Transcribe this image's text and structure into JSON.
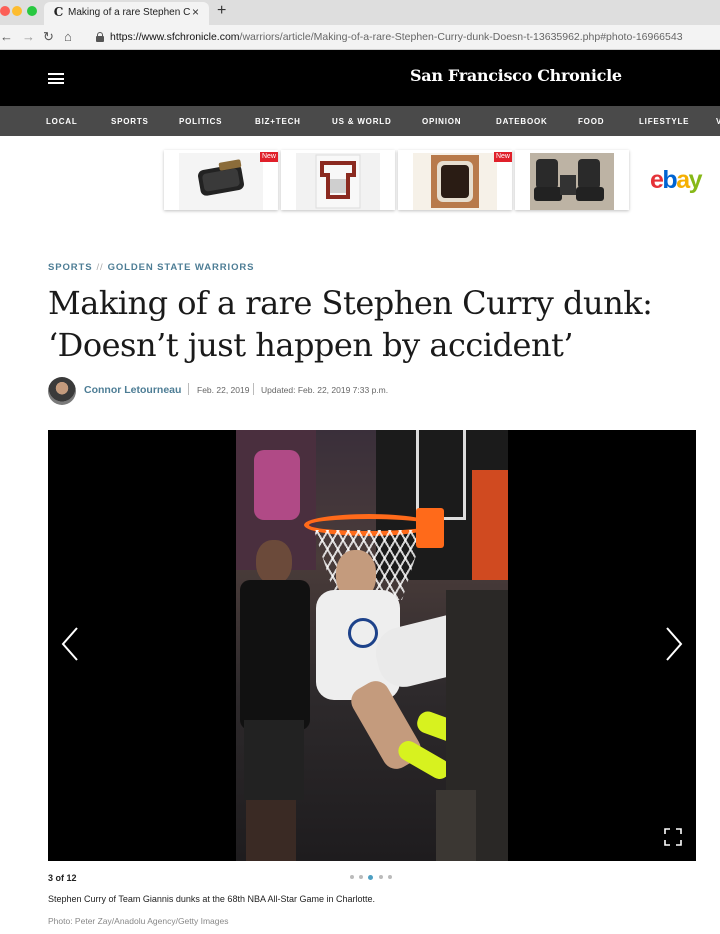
{
  "browser": {
    "tab_title": "Making of a rare Stephen Curry",
    "tab_favicon": "C",
    "new_tab_label": "+",
    "close_label": "×",
    "url_host": "https://www.sfchronicle.com",
    "url_path": "/warriors/article/Making-of-a-rare-Stephen-Curry-dunk-Doesn-t-13635962.php#photo-16966543",
    "icons": [
      "back-icon",
      "forward-icon",
      "reload-icon",
      "home-icon",
      "lock-icon"
    ]
  },
  "masthead": {
    "logo": "San Francisco Chronicle",
    "menu_icon": "hamburger-icon"
  },
  "nav": {
    "items": [
      "LOCAL",
      "SPORTS",
      "POLITICS",
      "BIZ+TECH",
      "US & WORLD",
      "OPINION",
      "DATEBOOK",
      "FOOD",
      "LIFESTYLE",
      "V"
    ]
  },
  "ads": {
    "items": [
      {
        "badge": "New",
        "subject": "car air vent"
      },
      {
        "badge": "",
        "subject": "red dashboard trim"
      },
      {
        "badge": "New",
        "subject": "wooden steering wheel"
      },
      {
        "badge": "",
        "subject": "black leather seats"
      }
    ],
    "brand": [
      "e",
      "b",
      "a",
      "y"
    ]
  },
  "article": {
    "section": "SPORTS",
    "separator": "//",
    "subsection": "GOLDEN STATE WARRIORS",
    "headline_line1": "Making of a rare Stephen Curry dunk:",
    "headline_line2": "‘Doesn’t just happen by accident’",
    "author": "Connor Letourneau",
    "published": "Feb. 22, 2019",
    "updated": "Updated: Feb. 22, 2019 7:33 p.m."
  },
  "gallery": {
    "counter": "3 of 12",
    "total_dots": 5,
    "active_dot": 2,
    "caption": "Stephen Curry of Team Giannis dunks at the 68th NBA All-Star Game in Charlotte.",
    "credit": "Photo: Peter Zay/Anadolu Agency/Getty Images",
    "icons": [
      "chevron-left-icon",
      "chevron-right-icon",
      "fullscreen-icon"
    ]
  }
}
